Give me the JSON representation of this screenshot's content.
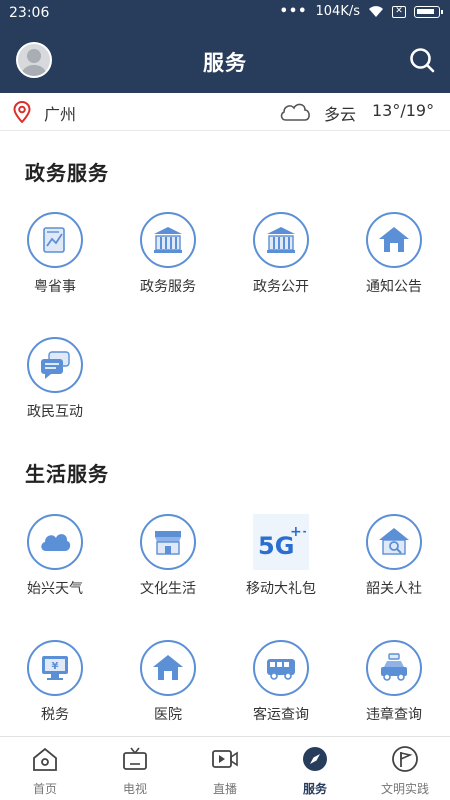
{
  "status_bar": {
    "time": "23:06",
    "network_speed": "104K/s",
    "dots": "•••"
  },
  "header": {
    "title": "服务"
  },
  "weather": {
    "city": "广州",
    "condition": "多云",
    "temperature": "13°/19°"
  },
  "sections": [
    {
      "title": "政务服务",
      "items": [
        {
          "label": "粤省事",
          "icon": "document-chart-icon"
        },
        {
          "label": "政务服务",
          "icon": "government-building-icon"
        },
        {
          "label": "政务公开",
          "icon": "government-building-icon"
        },
        {
          "label": "通知公告",
          "icon": "house-icon"
        },
        {
          "label": "政民互动",
          "icon": "chat-bubbles-icon"
        }
      ]
    },
    {
      "title": "生活服务",
      "items": [
        {
          "label": "始兴天气",
          "icon": "cloud-icon"
        },
        {
          "label": "文化生活",
          "icon": "shop-icon"
        },
        {
          "label": "移动大礼包",
          "icon": "5g-plus-icon"
        },
        {
          "label": "韶关人社",
          "icon": "house-search-icon"
        },
        {
          "label": "税务",
          "icon": "tax-monitor-icon"
        },
        {
          "label": "医院",
          "icon": "hospital-icon"
        },
        {
          "label": "客运查询",
          "icon": "bus-icon"
        },
        {
          "label": "违章查询",
          "icon": "car-icon"
        }
      ]
    }
  ],
  "bottom_nav": [
    {
      "label": "首页",
      "icon": "home-icon",
      "active": false
    },
    {
      "label": "电视",
      "icon": "tv-icon",
      "active": false
    },
    {
      "label": "直播",
      "icon": "live-video-icon",
      "active": false
    },
    {
      "label": "服务",
      "icon": "compass-icon",
      "active": true
    },
    {
      "label": "文明实践",
      "icon": "flag-circle-icon",
      "active": false
    }
  ],
  "colors": {
    "primary": "#283c5c",
    "icon_accent": "#5b8fd6",
    "location_pin": "#d9302c"
  }
}
